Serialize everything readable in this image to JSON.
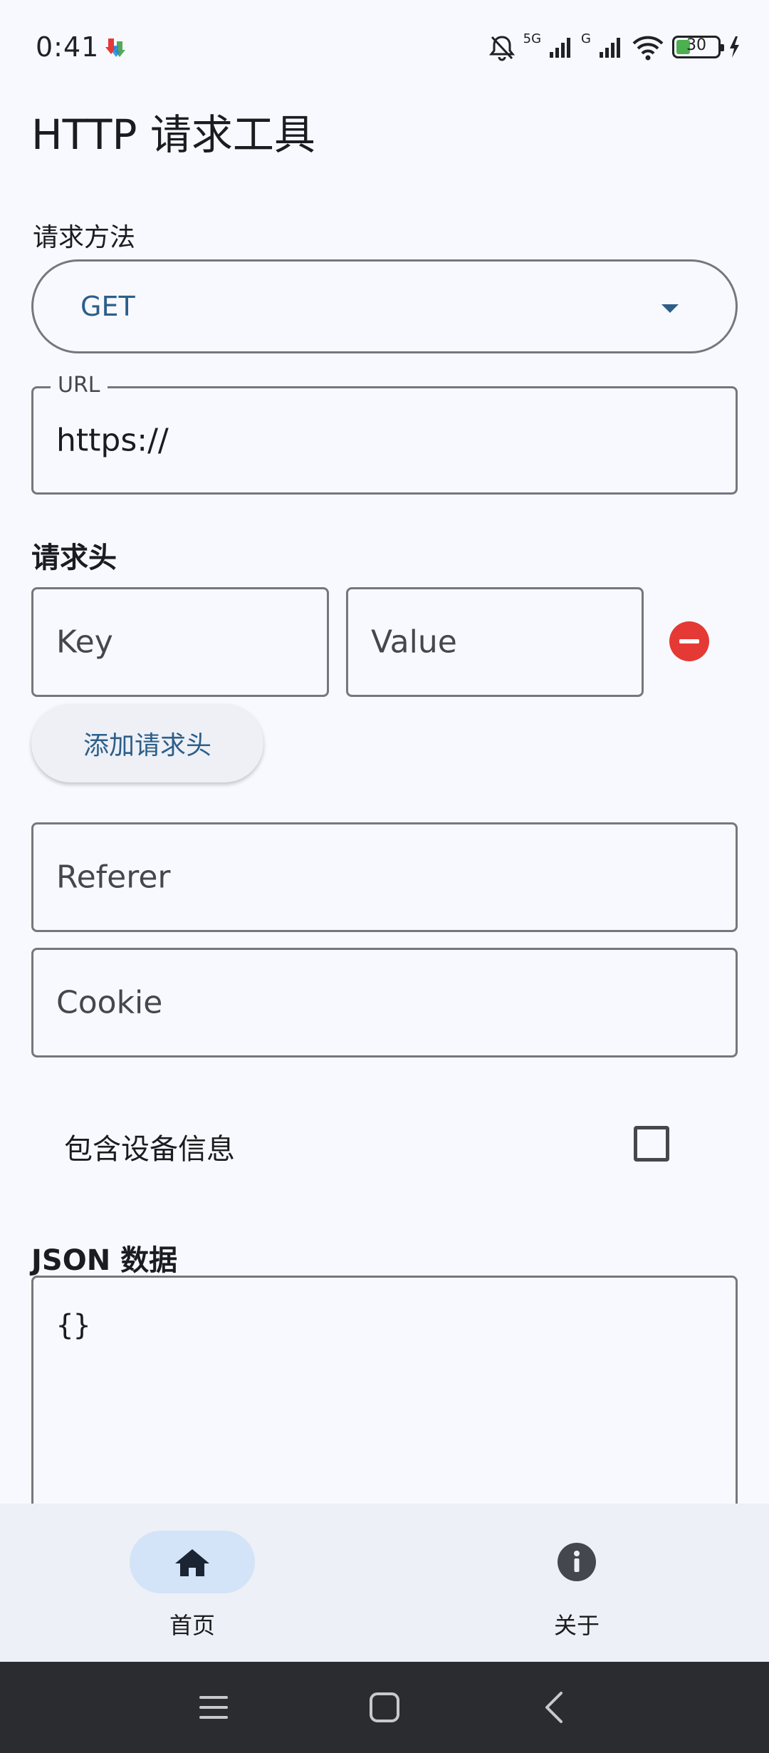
{
  "status_bar": {
    "time": "0:41",
    "network_1": "5G",
    "network_2": "G",
    "battery": "30"
  },
  "app": {
    "title": "HTTP 请求工具"
  },
  "method": {
    "label": "请求方法",
    "selected": "GET"
  },
  "url": {
    "label": "URL",
    "value": "https://"
  },
  "headers": {
    "heading": "请求头",
    "key_placeholder": "Key",
    "value_placeholder": "Value",
    "add_button": "添加请求头"
  },
  "referer": {
    "placeholder": "Referer"
  },
  "cookie": {
    "placeholder": "Cookie"
  },
  "device_info": {
    "label": "包含设备信息",
    "checked": false
  },
  "json": {
    "heading": "JSON 数据",
    "value": "{}"
  },
  "bottom_nav": {
    "items": [
      {
        "label": "首页",
        "icon": "home-icon",
        "active": true
      },
      {
        "label": "关于",
        "icon": "info-icon",
        "active": false
      }
    ]
  },
  "colors": {
    "accent": "#2c5f8a",
    "outline": "#74777f",
    "remove": "#e53935",
    "nav_active": "#d3e3f8"
  }
}
